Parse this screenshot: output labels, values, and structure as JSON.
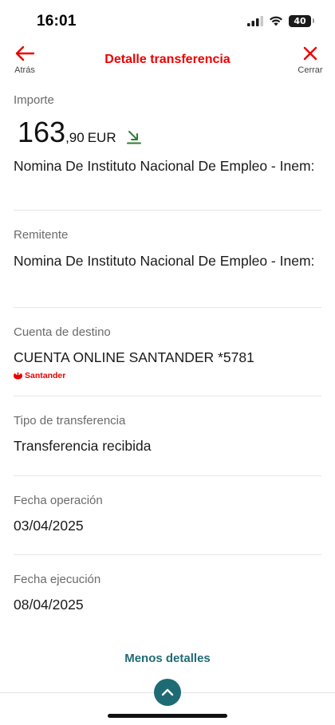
{
  "status_bar": {
    "time": "16:01",
    "battery": "40"
  },
  "header": {
    "title": "Detalle transferencia",
    "back_label": "Atrás",
    "close_label": "Cerrar"
  },
  "amount": {
    "label": "Importe",
    "integer": "163",
    "decimal": ",90",
    "currency": "EUR",
    "concept": "Nomina De Instituto Nacional De Empleo - Inem:"
  },
  "sender": {
    "label": "Remitente",
    "value": "Nomina De Instituto Nacional De Empleo - Inem:"
  },
  "destination": {
    "label": "Cuenta de destino",
    "value": "CUENTA ONLINE SANTANDER *5781",
    "bank": "Santander"
  },
  "transfer_type": {
    "label": "Tipo de transferencia",
    "value": "Transferencia recibida"
  },
  "operation_date": {
    "label": "Fecha operación",
    "value": "03/04/2025"
  },
  "execution_date": {
    "label": "Fecha ejecución",
    "value": "08/04/2025"
  },
  "footer": {
    "toggle_label": "Menos detalles"
  },
  "colors": {
    "brand_red": "#ec0000",
    "accent_teal": "#1f6b75",
    "income_green": "#2e7d32"
  },
  "icons": {
    "back": "arrow-left-icon",
    "close": "close-icon",
    "incoming": "arrow-down-right-icon",
    "collapse": "chevron-up-icon"
  }
}
